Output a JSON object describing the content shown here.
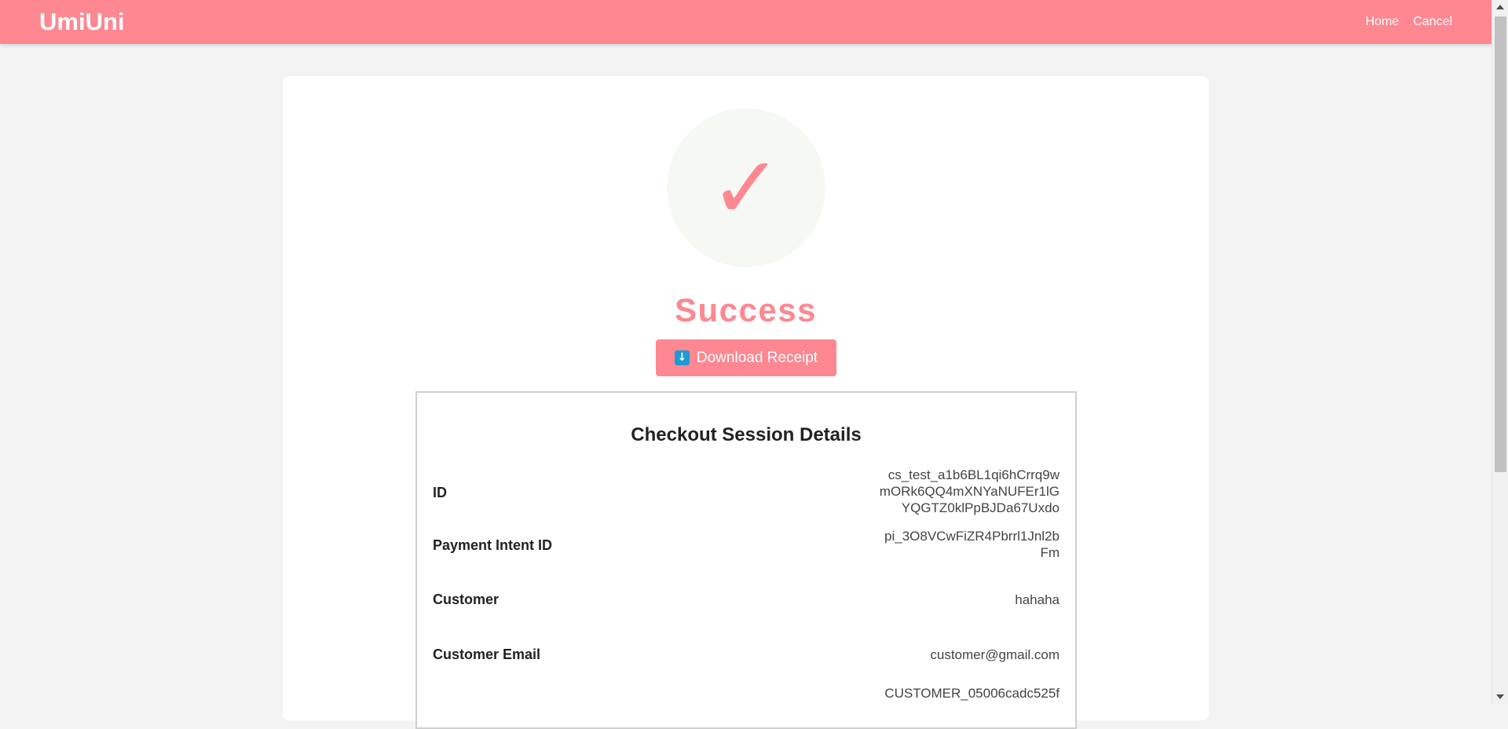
{
  "navbar": {
    "brand": "UmiUni",
    "links": [
      "Home",
      "Cancel"
    ]
  },
  "result": {
    "check_icon": "checkmark-icon",
    "title": "Success",
    "download_label": "Download Receipt",
    "download_icon": "download-arrow-icon"
  },
  "details": {
    "title": "Checkout Session Details",
    "rows": [
      {
        "label": "ID",
        "value": "cs_test_a1b6BL1qi6hCrrq9wmORk6QQ4mXNYaNUFEr1lGYQGTZ0klPpBJDa67Uxdo"
      },
      {
        "label": "Payment Intent ID",
        "value": "pi_3O8VCwFiZR4Pbrrl1Jnl2bFm"
      },
      {
        "label": "Customer",
        "value": "hahaha"
      },
      {
        "label": "Customer Email",
        "value": "customer@gmail.com"
      },
      {
        "label": "",
        "value": "CUSTOMER_05006cadc525f"
      }
    ]
  },
  "colors": {
    "brand": "#fd8892",
    "check_circle": "#f6f8f3",
    "download_icon": "#1e9ad6"
  }
}
